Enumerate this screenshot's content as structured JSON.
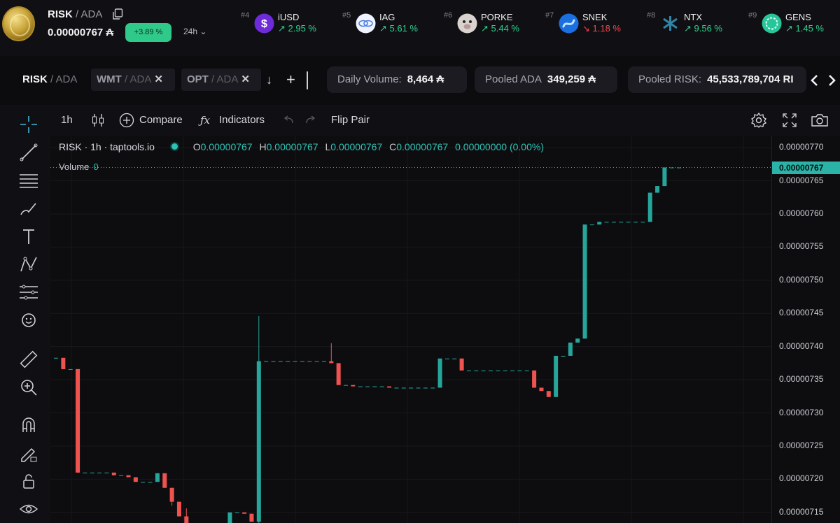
{
  "header": {
    "pair_base": "RISK",
    "pair_quote": " / ADA",
    "price": "0.00000767 ₳",
    "change": "+3.89 %",
    "timeframe": "24h ⌄"
  },
  "trending": [
    {
      "rank": "#4",
      "name": "iUSD",
      "change": "↗ 2.95 %",
      "direction": "up",
      "logo_color": "#6d2bd9",
      "icon": "dollar-icon"
    },
    {
      "rank": "#5",
      "name": "IAG",
      "change": "↗ 5.61 %",
      "direction": "up",
      "logo_color": "#e8f0ff",
      "icon": "iag-logo-icon"
    },
    {
      "rank": "#6",
      "name": "PORKE",
      "change": "↗ 5.44 %",
      "direction": "up",
      "logo_color": "#d8d0cc",
      "icon": "pig-face-icon"
    },
    {
      "rank": "#7",
      "name": "SNEK",
      "change": "↘ 1.18 %",
      "direction": "down",
      "logo_color": "#1c6fe0",
      "icon": "snake-icon"
    },
    {
      "rank": "#8",
      "name": "NTX",
      "change": "↗ 9.56 %",
      "direction": "up",
      "logo_color": "#2a6d8a",
      "icon": "ntx-logo-icon"
    },
    {
      "rank": "#9",
      "name": "GENS",
      "change": "↗ 1.45 %",
      "direction": "up",
      "logo_color": "#27c59a",
      "icon": "gens-logo-icon"
    }
  ],
  "tabs": [
    {
      "base": "RISK",
      "quote": " / ADA",
      "active": true
    },
    {
      "base": "WMT",
      "quote": " / ADA",
      "close": "✕"
    },
    {
      "base": "OPT",
      "quote": " / ADA",
      "close": "✕"
    }
  ],
  "tab_controls": {
    "down_arrow": "↓",
    "add": "+"
  },
  "stats": {
    "volume_label": "Daily Volume:",
    "volume_value": "8,464 ₳",
    "pooled_ada_label": "Pooled ADA",
    "pooled_ada_value": "349,259 ₳",
    "pooled_risk_label": "Pooled RISK:",
    "pooled_risk_value": "45,533,789,704 RI"
  },
  "toolbar": {
    "interval": "1h",
    "compare": "Compare",
    "indicators": "Indicators",
    "flip_pair": "Flip Pair"
  },
  "legend": {
    "title": "RISK · 1h · taptools.io",
    "o_label": "O",
    "o": "0.00000767",
    "h_label": "H",
    "h": "0.00000767",
    "l_label": "L",
    "l": "0.00000767",
    "c_label": "C",
    "c": "0.00000767",
    "change": "0.00000000 (0.00%)",
    "volume_label": "Volume",
    "volume_value": "0"
  },
  "last_price": "0.00000767",
  "chart_data": {
    "type": "candlestick",
    "interval": "1h",
    "y_ticks": [
      "0.00000770",
      "0.00000765",
      "0.00000760",
      "0.00000755",
      "0.00000750",
      "0.00000745",
      "0.00000740",
      "0.00000735",
      "0.00000730",
      "0.00000725",
      "0.00000720",
      "0.00000715"
    ],
    "ylim": [
      7.134e-06,
      7.718e-06
    ],
    "candles": [
      {
        "o": 7.383e-06,
        "h": 7.383e-06,
        "l": 7.383e-06,
        "c": 7.383e-06
      },
      {
        "o": 7.383e-06,
        "h": 7.383e-06,
        "l": 7.366e-06,
        "c": 7.366e-06
      },
      {
        "o": 7.366e-06,
        "h": 7.366e-06,
        "l": 7.366e-06,
        "c": 7.366e-06
      },
      {
        "o": 7.366e-06,
        "h": 7.366e-06,
        "l": 7.21e-06,
        "c": 7.21e-06
      },
      {
        "o": 7.21e-06,
        "h": 7.21e-06,
        "l": 7.21e-06,
        "c": 7.21e-06
      },
      {
        "o": 7.21e-06,
        "h": 7.21e-06,
        "l": 7.21e-06,
        "c": 7.21e-06
      },
      {
        "o": 7.21e-06,
        "h": 7.21e-06,
        "l": 7.21e-06,
        "c": 7.21e-06
      },
      {
        "o": 7.21e-06,
        "h": 7.21e-06,
        "l": 7.21e-06,
        "c": 7.21e-06
      },
      {
        "o": 7.21e-06,
        "h": 7.21e-06,
        "l": 7.206e-06,
        "c": 7.206e-06
      },
      {
        "o": 7.206e-06,
        "h": 7.206e-06,
        "l": 7.206e-06,
        "c": 7.206e-06
      },
      {
        "o": 7.206e-06,
        "h": 7.206e-06,
        "l": 7.203e-06,
        "c": 7.203e-06
      },
      {
        "o": 7.203e-06,
        "h": 7.203e-06,
        "l": 7.196e-06,
        "c": 7.196e-06
      },
      {
        "o": 7.196e-06,
        "h": 7.196e-06,
        "l": 7.196e-06,
        "c": 7.196e-06
      },
      {
        "o": 7.196e-06,
        "h": 7.196e-06,
        "l": 7.196e-06,
        "c": 7.196e-06
      },
      {
        "o": 7.196e-06,
        "h": 7.209e-06,
        "l": 7.196e-06,
        "c": 7.209e-06
      },
      {
        "o": 7.209e-06,
        "h": 7.209e-06,
        "l": 7.187e-06,
        "c": 7.187e-06
      },
      {
        "o": 7.187e-06,
        "h": 7.187e-06,
        "l": 7.16e-06,
        "c": 7.166e-06
      },
      {
        "o": 7.166e-06,
        "h": 7.166e-06,
        "l": 7.144e-06,
        "c": 7.144e-06
      },
      {
        "o": 7.144e-06,
        "h": 7.156e-06,
        "l": 7.13e-06,
        "c": 7.13e-06
      },
      {
        "o": 7.13e-06,
        "h": 7.13e-06,
        "l": 7.13e-06,
        "c": 7.13e-06
      },
      {
        "o": 7.13e-06,
        "h": 7.13e-06,
        "l": 7.13e-06,
        "c": 7.13e-06
      },
      {
        "o": 7.13e-06,
        "h": 7.13e-06,
        "l": 7.13e-06,
        "c": 7.13e-06
      },
      {
        "o": 7.13e-06,
        "h": 7.13e-06,
        "l": 7.13e-06,
        "c": 7.13e-06
      },
      {
        "o": 7.13e-06,
        "h": 7.13e-06,
        "l": 7.13e-06,
        "c": 7.13e-06
      },
      {
        "o": 7.13e-06,
        "h": 7.15e-06,
        "l": 7.13e-06,
        "c": 7.15e-06
      },
      {
        "o": 7.15e-06,
        "h": 7.15e-06,
        "l": 7.15e-06,
        "c": 7.15e-06
      },
      {
        "o": 7.15e-06,
        "h": 7.15e-06,
        "l": 7.148e-06,
        "c": 7.148e-06
      },
      {
        "o": 7.148e-06,
        "h": 7.148e-06,
        "l": 7.136e-06,
        "c": 7.136e-06
      },
      {
        "o": 7.136e-06,
        "h": 7.446e-06,
        "l": 7.12e-06,
        "c": 7.378e-06
      },
      {
        "o": 7.378e-06,
        "h": 7.378e-06,
        "l": 7.378e-06,
        "c": 7.378e-06
      },
      {
        "o": 7.378e-06,
        "h": 7.378e-06,
        "l": 7.378e-06,
        "c": 7.378e-06
      },
      {
        "o": 7.378e-06,
        "h": 7.378e-06,
        "l": 7.378e-06,
        "c": 7.378e-06
      },
      {
        "o": 7.378e-06,
        "h": 7.378e-06,
        "l": 7.378e-06,
        "c": 7.378e-06
      },
      {
        "o": 7.378e-06,
        "h": 7.378e-06,
        "l": 7.378e-06,
        "c": 7.378e-06
      },
      {
        "o": 7.378e-06,
        "h": 7.378e-06,
        "l": 7.378e-06,
        "c": 7.378e-06
      },
      {
        "o": 7.378e-06,
        "h": 7.378e-06,
        "l": 7.378e-06,
        "c": 7.378e-06
      },
      {
        "o": 7.378e-06,
        "h": 7.378e-06,
        "l": 7.378e-06,
        "c": 7.378e-06
      },
      {
        "o": 7.378e-06,
        "h": 7.378e-06,
        "l": 7.378e-06,
        "c": 7.378e-06
      },
      {
        "o": 7.378e-06,
        "h": 7.405e-06,
        "l": 7.375e-06,
        "c": 7.375e-06
      },
      {
        "o": 7.375e-06,
        "h": 7.375e-06,
        "l": 7.342e-06,
        "c": 7.342e-06
      },
      {
        "o": 7.342e-06,
        "h": 7.342e-06,
        "l": 7.342e-06,
        "c": 7.342e-06
      },
      {
        "o": 7.342e-06,
        "h": 7.342e-06,
        "l": 7.34e-06,
        "c": 7.34e-06
      },
      {
        "o": 7.34e-06,
        "h": 7.34e-06,
        "l": 7.34e-06,
        "c": 7.34e-06
      },
      {
        "o": 7.34e-06,
        "h": 7.34e-06,
        "l": 7.34e-06,
        "c": 7.34e-06
      },
      {
        "o": 7.34e-06,
        "h": 7.34e-06,
        "l": 7.34e-06,
        "c": 7.34e-06
      },
      {
        "o": 7.34e-06,
        "h": 7.34e-06,
        "l": 7.34e-06,
        "c": 7.34e-06
      },
      {
        "o": 7.34e-06,
        "h": 7.34e-06,
        "l": 7.338e-06,
        "c": 7.338e-06
      },
      {
        "o": 7.338e-06,
        "h": 7.338e-06,
        "l": 7.338e-06,
        "c": 7.338e-06
      },
      {
        "o": 7.338e-06,
        "h": 7.338e-06,
        "l": 7.338e-06,
        "c": 7.338e-06
      },
      {
        "o": 7.338e-06,
        "h": 7.338e-06,
        "l": 7.338e-06,
        "c": 7.338e-06
      },
      {
        "o": 7.338e-06,
        "h": 7.338e-06,
        "l": 7.338e-06,
        "c": 7.338e-06
      },
      {
        "o": 7.338e-06,
        "h": 7.338e-06,
        "l": 7.338e-06,
        "c": 7.338e-06
      },
      {
        "o": 7.338e-06,
        "h": 7.338e-06,
        "l": 7.338e-06,
        "c": 7.338e-06
      },
      {
        "o": 7.338e-06,
        "h": 7.382e-06,
        "l": 7.338e-06,
        "c": 7.382e-06
      },
      {
        "o": 7.382e-06,
        "h": 7.382e-06,
        "l": 7.382e-06,
        "c": 7.382e-06
      },
      {
        "o": 7.382e-06,
        "h": 7.382e-06,
        "l": 7.382e-06,
        "c": 7.382e-06
      },
      {
        "o": 7.382e-06,
        "h": 7.382e-06,
        "l": 7.364e-06,
        "c": 7.364e-06
      },
      {
        "o": 7.364e-06,
        "h": 7.364e-06,
        "l": 7.364e-06,
        "c": 7.364e-06
      },
      {
        "o": 7.364e-06,
        "h": 7.364e-06,
        "l": 7.364e-06,
        "c": 7.364e-06
      },
      {
        "o": 7.364e-06,
        "h": 7.364e-06,
        "l": 7.364e-06,
        "c": 7.364e-06
      },
      {
        "o": 7.364e-06,
        "h": 7.364e-06,
        "l": 7.364e-06,
        "c": 7.364e-06
      },
      {
        "o": 7.364e-06,
        "h": 7.364e-06,
        "l": 7.364e-06,
        "c": 7.364e-06
      },
      {
        "o": 7.364e-06,
        "h": 7.364e-06,
        "l": 7.364e-06,
        "c": 7.364e-06
      },
      {
        "o": 7.364e-06,
        "h": 7.364e-06,
        "l": 7.364e-06,
        "c": 7.364e-06
      },
      {
        "o": 7.364e-06,
        "h": 7.364e-06,
        "l": 7.364e-06,
        "c": 7.364e-06
      },
      {
        "o": 7.364e-06,
        "h": 7.364e-06,
        "l": 7.364e-06,
        "c": 7.364e-06
      },
      {
        "o": 7.364e-06,
        "h": 7.364e-06,
        "l": 7.338e-06,
        "c": 7.338e-06
      },
      {
        "o": 7.338e-06,
        "h": 7.338e-06,
        "l": 7.333e-06,
        "c": 7.333e-06
      },
      {
        "o": 7.333e-06,
        "h": 7.333e-06,
        "l": 7.324e-06,
        "c": 7.324e-06
      },
      {
        "o": 7.324e-06,
        "h": 7.386e-06,
        "l": 7.324e-06,
        "c": 7.386e-06
      },
      {
        "o": 7.386e-06,
        "h": 7.386e-06,
        "l": 7.386e-06,
        "c": 7.386e-06
      },
      {
        "o": 7.386e-06,
        "h": 7.406e-06,
        "l": 7.386e-06,
        "c": 7.406e-06
      },
      {
        "o": 7.406e-06,
        "h": 7.412e-06,
        "l": 7.406e-06,
        "c": 7.412e-06
      },
      {
        "o": 7.412e-06,
        "h": 7.584e-06,
        "l": 7.412e-06,
        "c": 7.584e-06
      },
      {
        "o": 7.584e-06,
        "h": 7.584e-06,
        "l": 7.584e-06,
        "c": 7.584e-06
      },
      {
        "o": 7.584e-06,
        "h": 7.588e-06,
        "l": 7.584e-06,
        "c": 7.588e-06
      },
      {
        "o": 7.588e-06,
        "h": 7.588e-06,
        "l": 7.588e-06,
        "c": 7.588e-06
      },
      {
        "o": 7.588e-06,
        "h": 7.588e-06,
        "l": 7.588e-06,
        "c": 7.588e-06
      },
      {
        "o": 7.588e-06,
        "h": 7.588e-06,
        "l": 7.588e-06,
        "c": 7.588e-06
      },
      {
        "o": 7.588e-06,
        "h": 7.588e-06,
        "l": 7.588e-06,
        "c": 7.588e-06
      },
      {
        "o": 7.588e-06,
        "h": 7.588e-06,
        "l": 7.588e-06,
        "c": 7.588e-06
      },
      {
        "o": 7.588e-06,
        "h": 7.588e-06,
        "l": 7.588e-06,
        "c": 7.588e-06
      },
      {
        "o": 7.588e-06,
        "h": 7.632e-06,
        "l": 7.588e-06,
        "c": 7.632e-06
      },
      {
        "o": 7.632e-06,
        "h": 7.642e-06,
        "l": 7.632e-06,
        "c": 7.642e-06
      },
      {
        "o": 7.642e-06,
        "h": 7.67e-06,
        "l": 7.642e-06,
        "c": 7.67e-06
      },
      {
        "o": 7.67e-06,
        "h": 7.67e-06,
        "l": 7.67e-06,
        "c": 7.67e-06
      },
      {
        "o": 7.67e-06,
        "h": 7.67e-06,
        "l": 7.67e-06,
        "c": 7.67e-06
      }
    ]
  },
  "colors": {
    "up": "#26a69a",
    "down": "#ef5350",
    "accent": "#2bb3a8"
  }
}
